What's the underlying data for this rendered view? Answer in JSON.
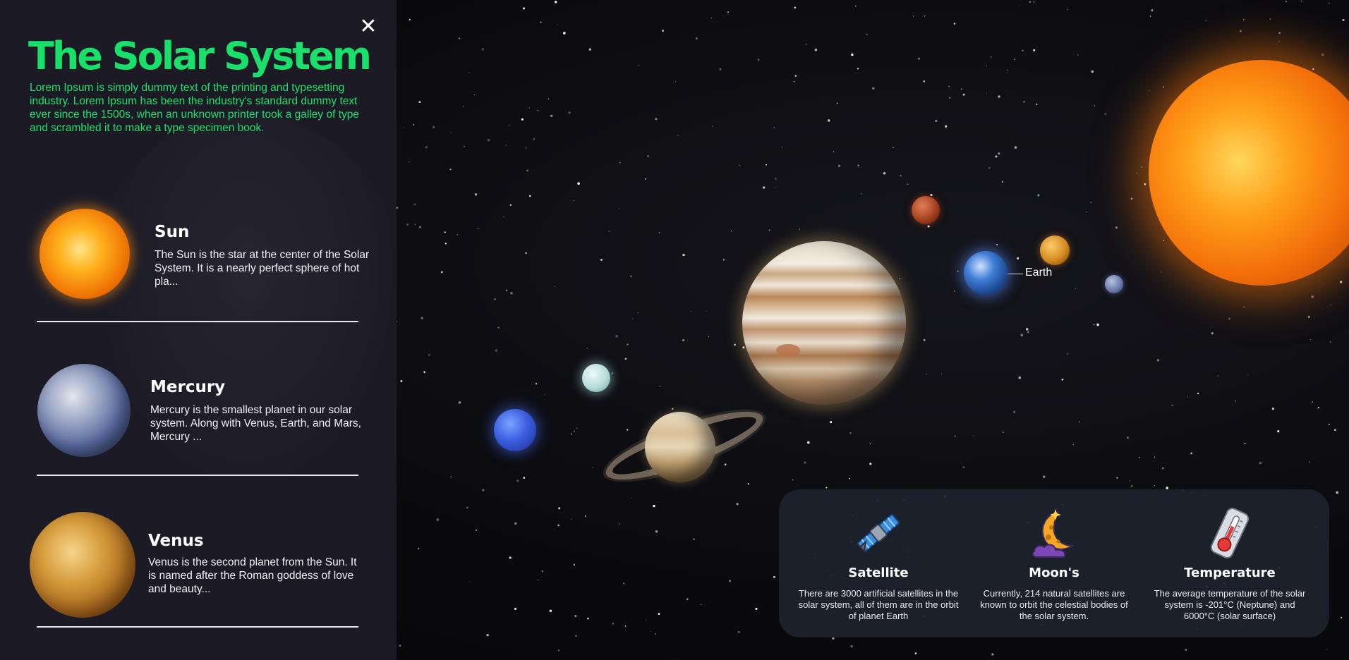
{
  "panel": {
    "title": "The Solar System",
    "intro": "Lorem Ipsum is simply dummy text of the printing and typesetting industry. Lorem Ipsum has been the industry's standard dummy text ever since the 1500s, when an unknown printer took a galley of type and scrambled it to make a type specimen book.",
    "close_icon": "close-icon",
    "planets": [
      {
        "name": "Sun",
        "description": "The Sun is the star at the center of the Solar System. It is a nearly perfect sphere of hot pla..."
      },
      {
        "name": "Mercury",
        "description": "Mercury is the smallest planet in our solar system. Along with Venus, Earth, and Mars, Mercury ..."
      },
      {
        "name": "Venus",
        "description": "Venus is the second planet from the Sun. It is named after the Roman goddess of love and beauty..."
      }
    ]
  },
  "scene": {
    "earth_label": "Earth"
  },
  "info_card": {
    "items": [
      {
        "icon": "satellite-icon",
        "title": "Satellite",
        "text": "There are 3000 artificial satellites in the solar system, all of them are in the orbit of planet Earth"
      },
      {
        "icon": "moon-icon",
        "title": "Moon's",
        "text": "Currently, 214 natural satellites are known to orbit the celestial bodies of the solar system."
      },
      {
        "icon": "thermometer-icon",
        "title": "Temperature",
        "text": "The average temperature of the solar system is -201°C (Neptune) and 6000°C (solar surface)"
      }
    ]
  },
  "colors": {
    "accent": "#19e06a",
    "panel_bg": "#1c1b25",
    "card_bg": "#1e222c"
  }
}
